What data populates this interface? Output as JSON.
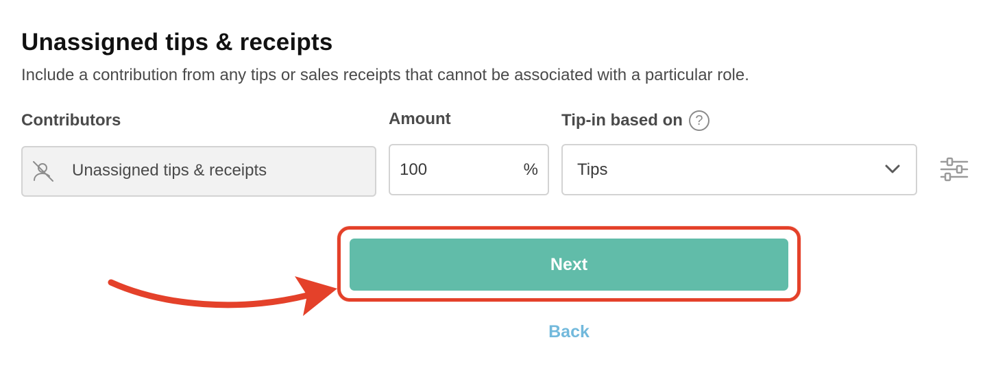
{
  "section": {
    "title": "Unassigned tips & receipts",
    "description": "Include a contribution from any tips or sales receipts that cannot be associated with a particular role."
  },
  "form": {
    "contributors": {
      "label": "Contributors",
      "value": "Unassigned tips & receipts",
      "icon": "user-off-icon"
    },
    "amount": {
      "label": "Amount",
      "value": "100",
      "unit": "%"
    },
    "tip_in": {
      "label": "Tip-in based on",
      "help_icon": "question-circle-icon",
      "help_glyph": "?",
      "selected": "Tips",
      "icon": "chevron-down-icon"
    },
    "settings_icon": "sliders-icon"
  },
  "actions": {
    "next_label": "Next",
    "back_label": "Back"
  },
  "annotation": {
    "color": "#e4412a"
  },
  "colors": {
    "primary_button": "#61bca9",
    "link": "#72b9dc",
    "field_border": "#d3d3d3",
    "disabled_field_bg": "#f2f2f2"
  }
}
